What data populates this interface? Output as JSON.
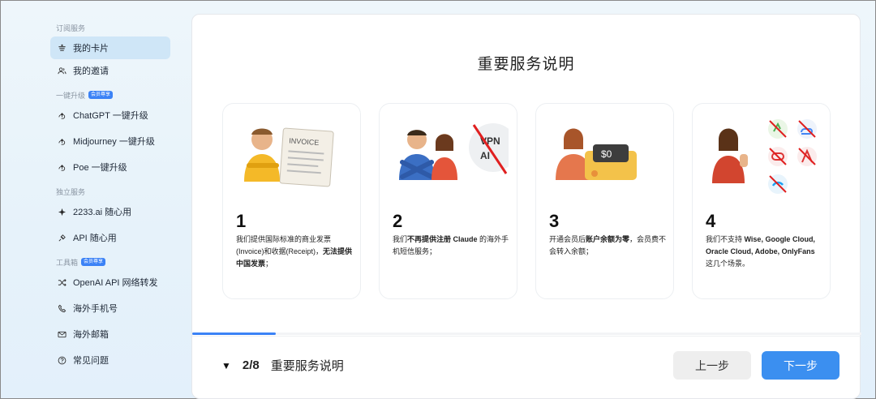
{
  "sidebar": {
    "groups": [
      {
        "title": "订阅服务",
        "badge": "",
        "items": [
          {
            "label": "我的卡片",
            "icon": "card-stack-icon",
            "active": true
          },
          {
            "label": "我的邀请",
            "icon": "users-icon",
            "active": false
          }
        ]
      },
      {
        "title": "一键升级",
        "badge": "会员尊享",
        "items": [
          {
            "label": "ChatGPT 一键升级",
            "icon": "upgrade-icon",
            "active": false
          },
          {
            "label": "Midjourney 一键升级",
            "icon": "upgrade-icon",
            "active": false
          },
          {
            "label": "Poe 一键升级",
            "icon": "upgrade-icon",
            "active": false
          }
        ]
      },
      {
        "title": "独立服务",
        "badge": "",
        "items": [
          {
            "label": "2233.ai 随心用",
            "icon": "sparkle-icon",
            "active": false
          },
          {
            "label": "API 随心用",
            "icon": "plug-icon",
            "active": false
          }
        ]
      },
      {
        "title": "工具箱",
        "badge": "会员尊享",
        "items": [
          {
            "label": "OpenAI API 网络转发",
            "icon": "shuffle-icon",
            "active": false
          },
          {
            "label": "海外手机号",
            "icon": "phone-icon",
            "active": false
          },
          {
            "label": "海外邮箱",
            "icon": "mail-icon",
            "active": false
          },
          {
            "label": "常见问题",
            "icon": "help-icon",
            "active": false
          }
        ]
      }
    ]
  },
  "main": {
    "title": "重要服务说明",
    "cards": [
      {
        "num": "1",
        "art": "invoice-illustration",
        "desc_html": "我们提供国际标准的商业发票(Invoice)和收据(Receipt)，<b>无法提供中国发票</b>；"
      },
      {
        "num": "2",
        "art": "no-vpn-illustration",
        "desc_html": "我们<b>不再提供注册 Claude</b> 的海外手机短信服务；"
      },
      {
        "num": "3",
        "art": "balance-illustration",
        "desc_html": "开通会员后<b>账户余额为零</b>，会员费不会转入余额；"
      },
      {
        "num": "4",
        "art": "unsupported-services-illustration",
        "desc_html": "我们不支持 <b>Wise, Google Cloud, Oracle Cloud, Adobe, OnlyFans</b> 这几个场景。"
      }
    ],
    "art_text": {
      "invoice": "INVOICE",
      "vpn": "VPN",
      "ai": "AI",
      "money": "$0"
    },
    "progress": 0.125,
    "footer": {
      "step": "2/8",
      "title": "重要服务说明",
      "prev": "上一步",
      "next": "下一步"
    }
  },
  "colors": {
    "accent": "#3b8ff0",
    "active_nav": "#cfe6f7"
  }
}
